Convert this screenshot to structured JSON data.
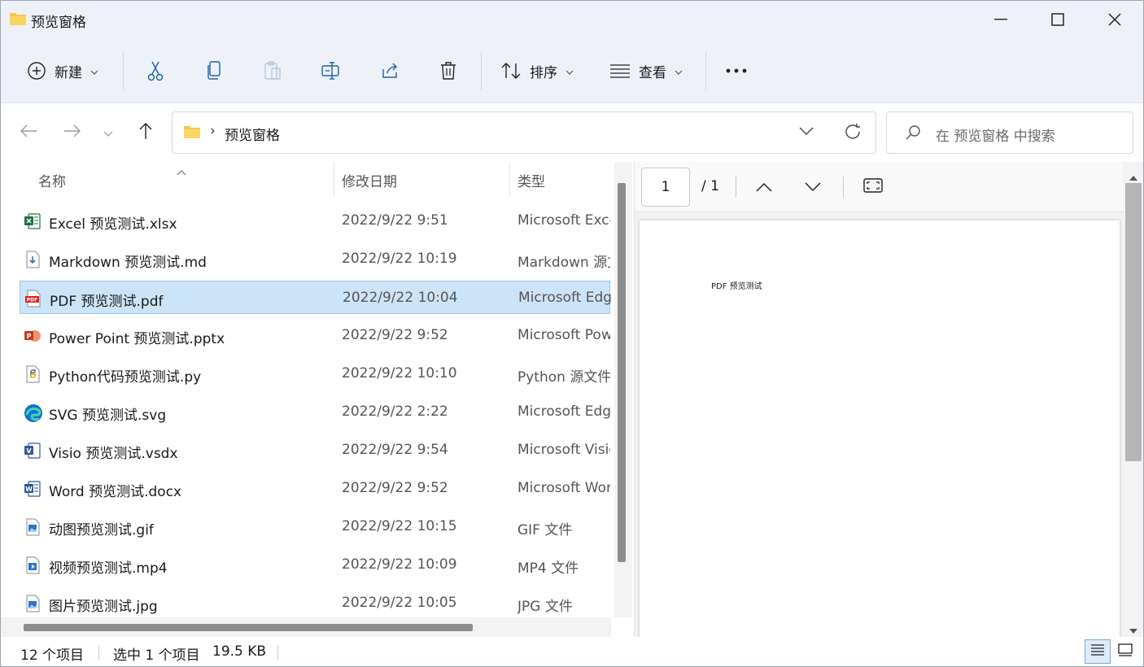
{
  "window": {
    "title": "预览窗格"
  },
  "toolbar": {
    "new_label": "新建",
    "sort_label": "排序",
    "view_label": "查看"
  },
  "address": {
    "path": "预览窗格",
    "separator": "›"
  },
  "search": {
    "placeholder": "在 预览窗格 中搜索"
  },
  "columns": {
    "name": "名称",
    "date": "修改日期",
    "type": "类型"
  },
  "files": [
    {
      "name": "Excel 预览测试.xlsx",
      "date": "2022/9/22 9:51",
      "type": "Microsoft Excel",
      "icon": "excel-icon",
      "selected": false
    },
    {
      "name": "Markdown 预览测试.md",
      "date": "2022/9/22 10:19",
      "type": "Markdown 源文件",
      "icon": "markdown-file-icon",
      "selected": false
    },
    {
      "name": "PDF 预览测试.pdf",
      "date": "2022/9/22 10:04",
      "type": "Microsoft Edge",
      "icon": "pdf-icon",
      "selected": true
    },
    {
      "name": "Power Point 预览测试.pptx",
      "date": "2022/9/22 9:52",
      "type": "Microsoft PowerPoint",
      "icon": "powerpoint-icon",
      "selected": false
    },
    {
      "name": "Python代码预览测试.py",
      "date": "2022/9/22 10:10",
      "type": "Python 源文件",
      "icon": "python-file-icon",
      "selected": false
    },
    {
      "name": "SVG 预览测试.svg",
      "date": "2022/9/22 2:22",
      "type": "Microsoft Edge",
      "icon": "edge-icon",
      "selected": false
    },
    {
      "name": "Visio 预览测试.vsdx",
      "date": "2022/9/22 9:54",
      "type": "Microsoft Visio",
      "icon": "visio-icon",
      "selected": false
    },
    {
      "name": "Word 预览测试.docx",
      "date": "2022/9/22 9:52",
      "type": "Microsoft Word",
      "icon": "word-icon",
      "selected": false
    },
    {
      "name": "动图预览测试.gif",
      "date": "2022/9/22 10:15",
      "type": "GIF 文件",
      "icon": "image-file-icon",
      "selected": false
    },
    {
      "name": "视频预览测试.mp4",
      "date": "2022/9/22 10:09",
      "type": "MP4 文件",
      "icon": "video-file-icon",
      "selected": false
    },
    {
      "name": "图片预览测试.jpg",
      "date": "2022/9/22 10:05",
      "type": "JPG 文件",
      "icon": "image-file-icon",
      "selected": false
    }
  ],
  "preview": {
    "page_current": "1",
    "page_total": "/ 1",
    "content_text": "PDF 预览测试"
  },
  "status": {
    "count": "12 个项目",
    "selected": "选中 1 个项目",
    "size": "19.5 KB"
  },
  "colors": {
    "selection_bg": "#cce4f7",
    "selection_border": "#99c9ef",
    "folder_yellow": "#f8c84a",
    "accent": "#0067c0"
  }
}
